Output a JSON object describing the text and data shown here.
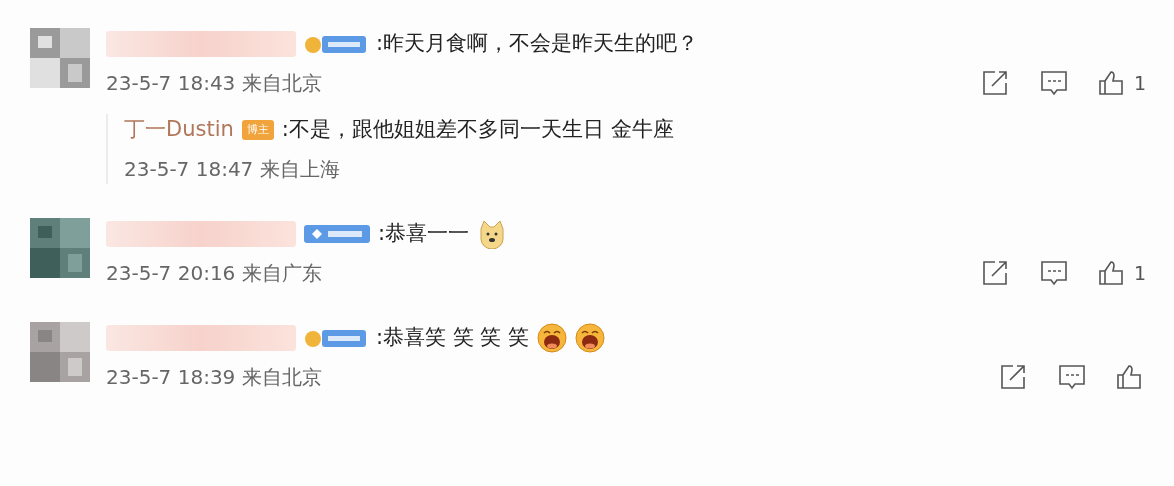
{
  "comments": [
    {
      "name_redacted": true,
      "badge": {
        "kind": "bear"
      },
      "text": ":昨天月食啊，不会是昨天生的吧？",
      "time": "23-5-7 18:43 来自北京",
      "likes": "1",
      "replies": [
        {
          "author": "丁一Dustin",
          "badge": "博主",
          "text": ":不是，跟他姐姐差不多同一天生日 金牛座",
          "time": "23-5-7 18:47 来自上海"
        }
      ]
    },
    {
      "name_redacted": true,
      "badge": {
        "kind": "diamond"
      },
      "text": ":恭喜一一",
      "emojis": [
        {
          "kind": "doge"
        }
      ],
      "time": "23-5-7 20:16 来自广东",
      "likes": "1"
    },
    {
      "name_redacted": true,
      "badge": {
        "kind": "bear"
      },
      "text": ":恭喜笑 笑 笑 笑",
      "emojis": [
        {
          "kind": "laugh"
        },
        {
          "kind": "laugh"
        }
      ],
      "time": "23-5-7 18:39 来自北京"
    }
  ]
}
